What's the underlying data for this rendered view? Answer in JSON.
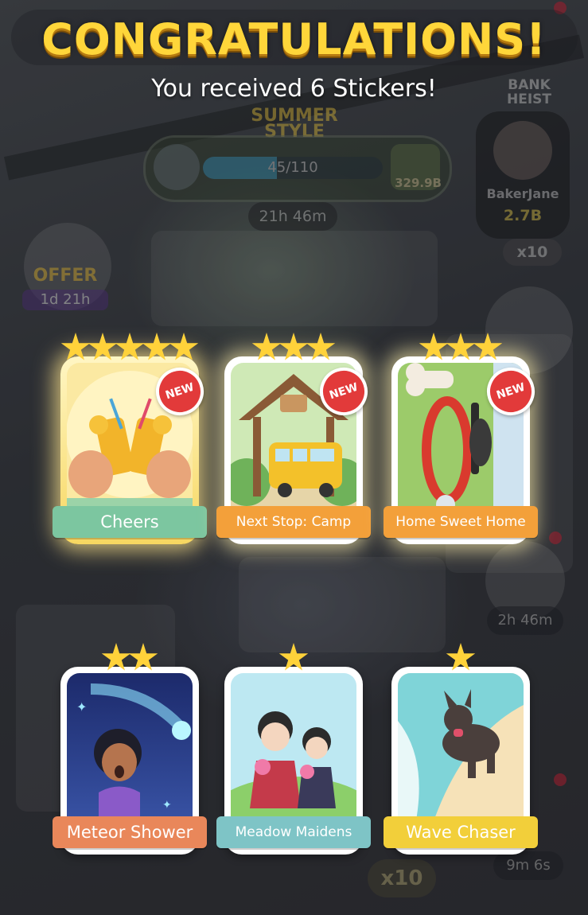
{
  "header": {
    "title": "CONGRATULATIONS!",
    "subtitle": "You received 6 Stickers!"
  },
  "background_hud": {
    "event_name": "SUMMER STYLE",
    "progress": {
      "text": "45/110",
      "fraction": 0.41
    },
    "reward_amount": "329.9B",
    "event_timer": "21h 46m",
    "offer": {
      "label": "OFFER",
      "timer": "1d 21h"
    },
    "bank_heist": {
      "title": "BANK HEIST",
      "player": "BakerJane",
      "amount": "2.7B",
      "multiplier": "x10"
    },
    "right_timers": [
      "2h 46m",
      "9m 6s"
    ],
    "bottom_multiplier": "x10"
  },
  "stickers": [
    {
      "name": "Cheers",
      "stars": 5,
      "is_new": true,
      "label_color": "#7cc6a0",
      "art": "lemonade-icon",
      "gold": true
    },
    {
      "name": "Next Stop: Camp",
      "stars": 3,
      "is_new": true,
      "label_color": "#f3a03a",
      "art": "school-bus-icon"
    },
    {
      "name": "Home Sweet Home",
      "stars": 3,
      "is_new": true,
      "label_color": "#f3a03a",
      "art": "dog-collar-icon"
    },
    {
      "name": "Meteor Shower",
      "stars": 2,
      "is_new": false,
      "label_color": "#e9875a",
      "art": "meteor-icon"
    },
    {
      "name": "Meadow Maidens",
      "stars": 1,
      "is_new": false,
      "label_color": "#7ec4c6",
      "art": "maidens-icon"
    },
    {
      "name": "Wave Chaser",
      "stars": 1,
      "is_new": false,
      "label_color": "#f2cf3a",
      "art": "dog-beach-icon"
    }
  ],
  "new_badge_text": "NEW"
}
